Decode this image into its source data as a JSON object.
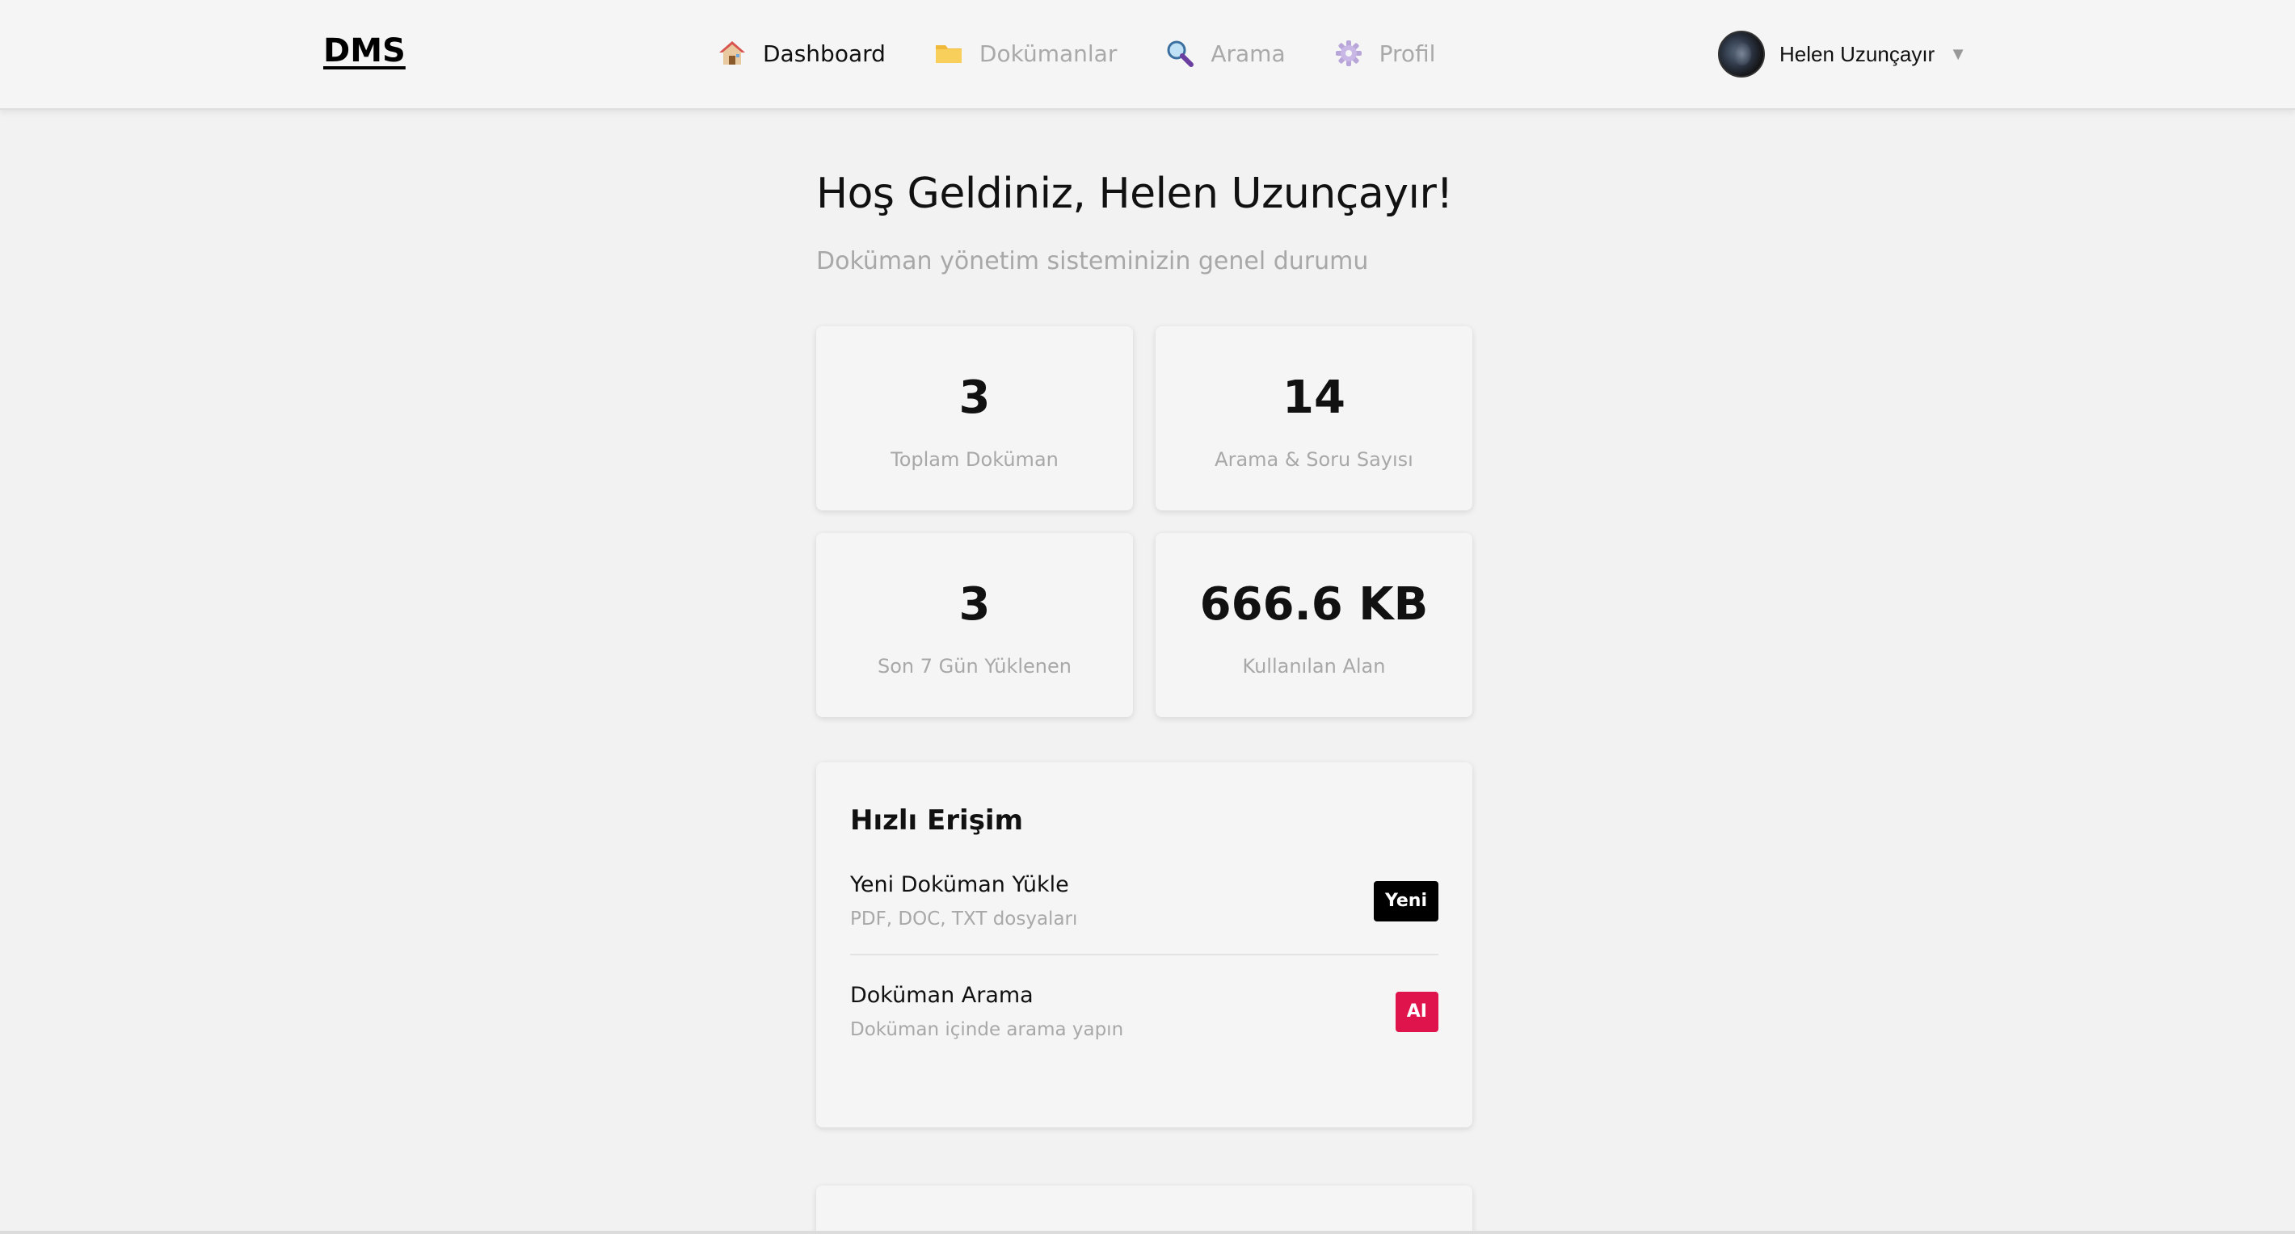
{
  "header": {
    "brand": "DMS",
    "nav": [
      {
        "label": "Dashboard",
        "icon": "house-icon",
        "active": true
      },
      {
        "label": "Dokümanlar",
        "icon": "folder-icon",
        "active": false
      },
      {
        "label": "Arama",
        "icon": "magnifier-icon",
        "active": false
      },
      {
        "label": "Profil",
        "icon": "gear-icon",
        "active": false
      }
    ],
    "user": {
      "name": "Helen Uzunçayır",
      "caret": "▼"
    }
  },
  "welcome": {
    "title": "Hoş Geldiniz, Helen Uzunçayır!",
    "subtitle": "Doküman yönetim sisteminizin genel durumu"
  },
  "stats": [
    {
      "value": "3",
      "label": "Toplam Doküman"
    },
    {
      "value": "14",
      "label": "Arama & Soru Sayısı"
    },
    {
      "value": "3",
      "label": "Son 7 Gün Yüklenen"
    },
    {
      "value": "666.6 KB",
      "label": "Kullanılan Alan"
    }
  ],
  "quick_access": {
    "title": "Hızlı Erişim",
    "items": [
      {
        "title": "Yeni Doküman Yükle",
        "description": "PDF, DOC, TXT dosyaları",
        "badge": "Yeni",
        "badge_color": "#000000"
      },
      {
        "title": "Doküman Arama",
        "description": "Doküman içinde arama yapın",
        "badge": "AI",
        "badge_color": "#e0144c"
      }
    ]
  },
  "colors": {
    "background": "#f2f2f2",
    "muted_text": "#a8a8a8",
    "accent_pink": "#e0144c"
  }
}
